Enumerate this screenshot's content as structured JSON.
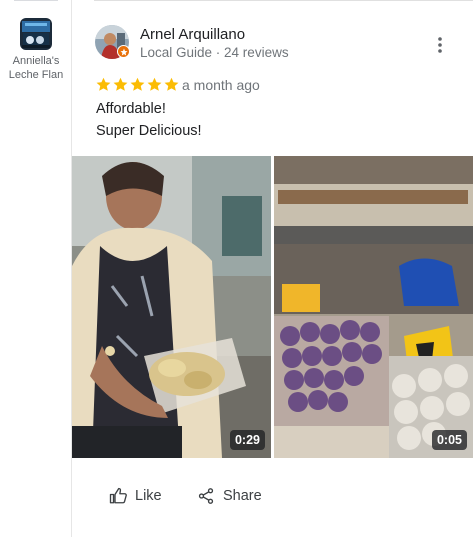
{
  "sidebar": {
    "place_name": "Anniella's Leche Flan"
  },
  "review": {
    "reviewer_name": "Arnel Arquillano",
    "reviewer_meta": "Local Guide · 24 reviews",
    "rating": 5,
    "date": "a month ago",
    "text_lines": [
      "Affordable!",
      "Super Delicious!"
    ],
    "media": [
      {
        "type": "video",
        "duration": "0:29",
        "icon": "video-thumbnail"
      },
      {
        "type": "video",
        "duration": "0:05",
        "icon": "video-thumbnail"
      }
    ]
  },
  "actions": {
    "like_label": "Like",
    "share_label": "Share"
  },
  "colors": {
    "star": "#fbbc04",
    "text_primary": "#202124",
    "text_secondary": "#70757a",
    "badge_orange": "#e8710a"
  },
  "icons": [
    "more-vertical-icon",
    "thumbs-up-icon",
    "share-icon",
    "star-icon",
    "local-guide-badge-icon"
  ]
}
